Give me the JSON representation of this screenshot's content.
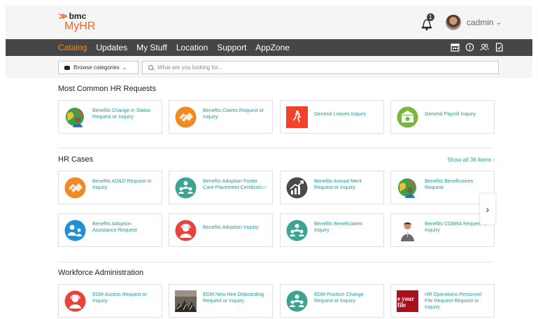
{
  "app": {
    "brand": "bmc",
    "name": "MyHR"
  },
  "header": {
    "notification_count": "1",
    "username": "cadmin"
  },
  "nav": {
    "items": [
      {
        "label": "Catalog",
        "active": true
      },
      {
        "label": "Updates",
        "active": false
      },
      {
        "label": "My Stuff",
        "active": false
      },
      {
        "label": "Location",
        "active": false
      },
      {
        "label": "Support",
        "active": false
      },
      {
        "label": "AppZone",
        "active": false
      }
    ],
    "icons": [
      "calendar-icon",
      "alert-icon",
      "people-icon",
      "document-icon"
    ]
  },
  "search": {
    "browse_label": "Browse categories",
    "placeholder": "What are you looking for..."
  },
  "sections": {
    "common": {
      "title": "Most Common HR Requests",
      "cards": [
        {
          "label": "Benefits Change in Status Request or Inquiry",
          "icon": "globe-person-icon"
        },
        {
          "label": "Benefits Claims Request or Inquiry",
          "icon": "handshake-icon"
        },
        {
          "label": "General Leaves Inquiry",
          "icon": "exit-icon"
        },
        {
          "label": "General Payroll Inquiry",
          "icon": "money-icon"
        }
      ]
    },
    "cases": {
      "title": "HR Cases",
      "show_all": "Show all 36 items",
      "cards": [
        {
          "label": "Benefits AD&D Request or Inquiry",
          "icon": "handshake-icon"
        },
        {
          "label": "Benefits Adoption Foster Care Placement Certification",
          "icon": "family-icon"
        },
        {
          "label": "Benefits Annual Merit Request or Inquiry",
          "icon": "growth-chart-icon"
        },
        {
          "label": "Benefits Beneficiaries Request",
          "icon": "globe-person-icon"
        },
        {
          "label": "Benefits Adoption Assistance Request",
          "icon": "adoption-icon"
        },
        {
          "label": "Benefits Adoption Inquiry",
          "icon": "support-agent-icon"
        },
        {
          "label": "Benefits Beneficiaries Inquiry",
          "icon": "family-icon"
        },
        {
          "label": "Benefits COBRA Request or Inquiry",
          "icon": "person-photo-icon"
        }
      ]
    },
    "workforce": {
      "title": "Workforce Administration",
      "cards": [
        {
          "label": "EDM Access Request or Inquiry",
          "icon": "support-agent-icon"
        },
        {
          "label": "EDM New Hire Onboarding Request or Inquiry",
          "icon": "photo-icon"
        },
        {
          "label": "EDM Position Change Request or Inquiry",
          "icon": "family-icon"
        },
        {
          "label": "HR Operations Personnel File Request Request or Inquiry",
          "icon": "your-file-icon",
          "icon_text": "e your file"
        }
      ]
    }
  }
}
